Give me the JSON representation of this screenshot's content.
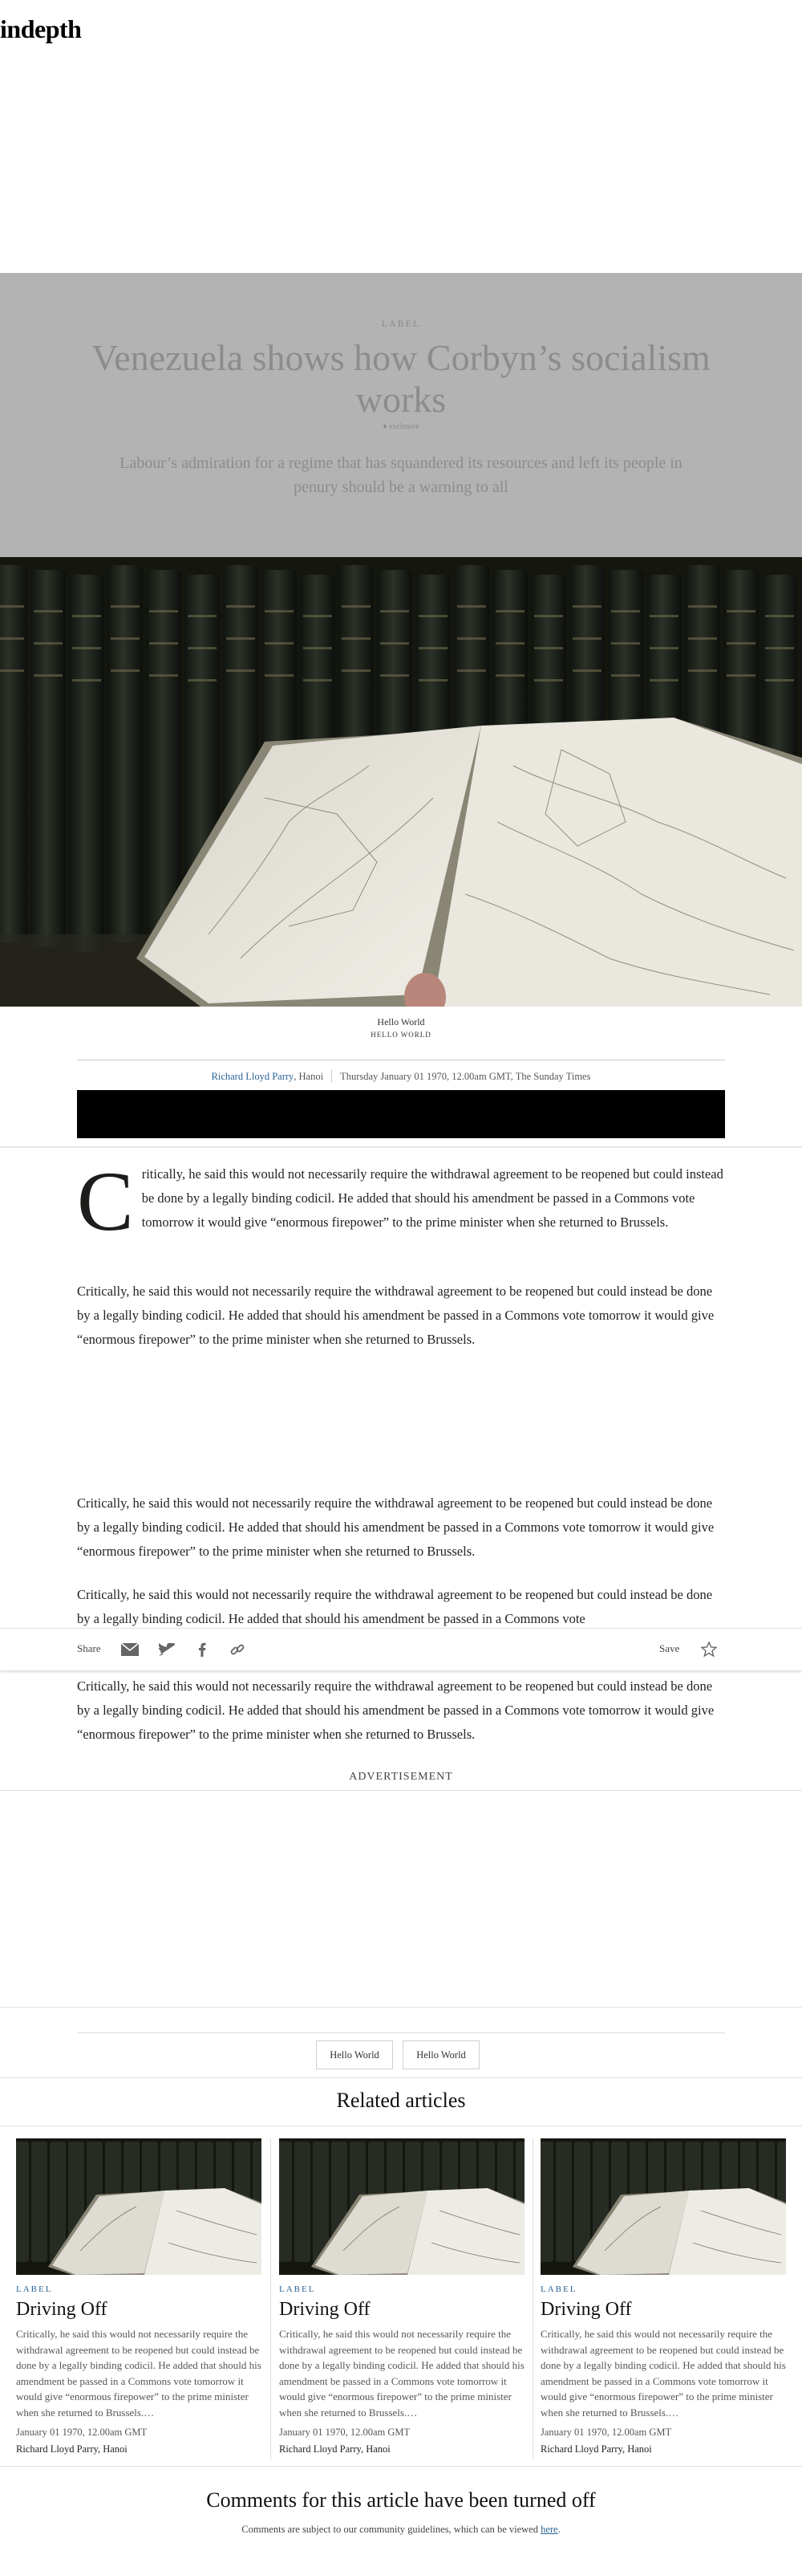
{
  "site": {
    "logo": "indepth"
  },
  "hero": {
    "label": "LABEL",
    "title": "Venezuela shows how Corbyn’s socialism works",
    "exclusive": "♦ exclusive",
    "standfirst": "Labour’s admiration for a regime that has squandered its resources and left its people in penury should be a warning to all"
  },
  "image": {
    "caption": "Hello World",
    "credit": "HELLO WORLD"
  },
  "byline": {
    "author": "Richard Lloyd Parry",
    "location": ", Hanoi",
    "date": "Thursday January 01 1970, 12.00am GMT, The Sunday Times"
  },
  "article": {
    "dropcap": "C",
    "first_paragraph": "ritically, he said this would not necessarily require the withdrawal agreement to be reopened but could instead be done by a legally binding codicil. He added that should his amendment be passed in a Commons vote tomorrow it would give “enormous firepower” to the prime minister when she returned to Brussels.",
    "paragraphs": [
      "Critically, he said this would not necessarily require the withdrawal agreement to be reopened but could instead be done by a legally binding codicil. He added that should his amendment be passed in a Commons vote tomorrow it would give “enormous firepower” to the prime minister when she returned to Brussels.",
      "Critically, he said this would not necessarily require the withdrawal agreement to be reopened but could instead be done by a legally binding codicil. He added that should his amendment be passed in a Commons vote tomorrow it would give “enormous firepower” to the prime minister when she returned to Brussels.",
      "Critically, he said this would not necessarily require the withdrawal agreement to be reopened but could instead be done by a legally binding codicil. He added that should his amendment be passed in a Commons vote",
      "Critically, he said this would not necessarily require the withdrawal agreement to be reopened but could instead be done by a legally binding codicil. He added that should his amendment be passed in a Commons vote tomorrow it would give “enormous firepower” to the prime minister when she returned to Brussels."
    ]
  },
  "share_bar": {
    "share_label": "Share",
    "save_label": "Save",
    "icons": [
      "email-icon",
      "twitter-icon",
      "facebook-icon",
      "link-icon",
      "star-icon"
    ]
  },
  "advertisement": {
    "label": "ADVERTISEMENT"
  },
  "tags": [
    "Hello World",
    "Hello World"
  ],
  "related": {
    "heading": "Related articles",
    "cards": [
      {
        "label": "LABEL",
        "title": "Driving Off",
        "text": "Critically, he said this would not necessarily require the withdrawal agreement to be reopened but could instead be done by a legally binding codicil. He added that should his amendment be passed in a Commons vote tomorrow it would give “enormous firepower” to the prime minister when she returned to Brussels.…",
        "date": "January 01 1970, 12.00am GMT",
        "author": "Richard Lloyd Parry, Hanoi"
      },
      {
        "label": "LABEL",
        "title": "Driving Off",
        "text": "Critically, he said this would not necessarily require the withdrawal agreement to be reopened but could instead be done by a legally binding codicil. He added that should his amendment be passed in a Commons vote tomorrow it would give “enormous firepower” to the prime minister when she returned to Brussels.…",
        "date": "January 01 1970, 12.00am GMT",
        "author": "Richard Lloyd Parry, Hanoi"
      },
      {
        "label": "LABEL",
        "title": "Driving Off",
        "text": "Critically, he said this would not necessarily require the withdrawal agreement to be reopened but could instead be done by a legally binding codicil. He added that should his amendment be passed in a Commons vote tomorrow it would give “enormous firepower” to the prime minister when she returned to Brussels.…",
        "date": "January 01 1970, 12.00am GMT",
        "author": "Richard Lloyd Parry, Hanoi"
      }
    ]
  },
  "comments": {
    "heading": "Comments for this article have been turned off",
    "note": "Comments are subject to our community guidelines, which can be viewed ",
    "link_text": "here",
    "note_end": "."
  },
  "colors": {
    "hero_overlay": "#b3b3b3",
    "link": "#2a6496",
    "text": "#1d1d1b"
  }
}
